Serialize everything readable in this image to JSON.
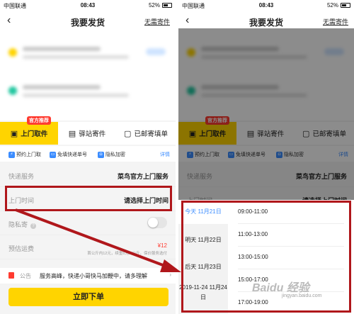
{
  "status_bar": {
    "carrier": "中国联通",
    "time": "08:43",
    "battery": "52%"
  },
  "nav": {
    "back": "‹",
    "title": "我要发货",
    "right_link": "无需寄件"
  },
  "tabs": [
    {
      "label": "上门取件",
      "icon": "truck-icon",
      "badge": "官方推荐"
    },
    {
      "label": "驿站寄件",
      "icon": "store-icon"
    },
    {
      "label": "已邮寄填单",
      "icon": "form-icon"
    }
  ],
  "features": [
    "预约上门取",
    "免填快递单号",
    "隐私加密"
  ],
  "features_detail": "详情",
  "form": {
    "service_label": "快递服务",
    "service_value": "菜鸟官方上门服务",
    "time_label": "上门时间",
    "time_value": "请选择上门时间",
    "privacy_label": "隐私寄",
    "price_label": "预估运费",
    "price_value": "¥12",
    "price_note": "首公斤内12元，续重6元/1公斤，保价服务选付"
  },
  "notice": {
    "label": "公告",
    "text": "服务高峰，快递小哥快马加鞭中，请多理解",
    "chevron": "›"
  },
  "submit_label": "立即下单",
  "picker": {
    "days": [
      "今天 11月21日",
      "明天 11月22日",
      "后天 11月23日",
      "2019-11-24 11月24日"
    ],
    "slots": [
      "09:00-11:00",
      "11:00-13:00",
      "13:00-15:00",
      "15:00-17:00",
      "17:00-19:00"
    ]
  },
  "colors": {
    "accent": "#ffd400",
    "highlight": "#b0171b",
    "link": "#3b8cff",
    "price": "#ff3b30"
  },
  "watermark": {
    "main": "Baidu 经验",
    "sub": "jingyan.baidu.com"
  }
}
